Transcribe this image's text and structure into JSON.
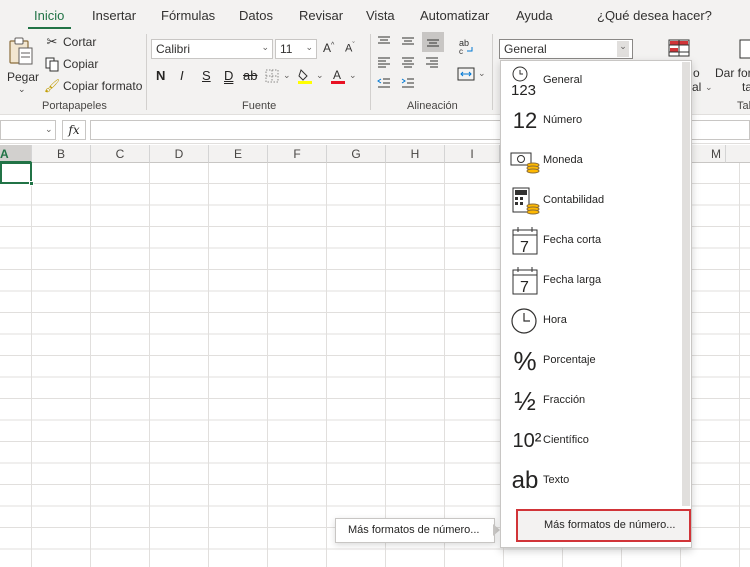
{
  "tabs": [
    {
      "label": "Inicio",
      "active": true
    },
    {
      "label": "Insertar"
    },
    {
      "label": "Fórmulas"
    },
    {
      "label": "Datos"
    },
    {
      "label": "Revisar"
    },
    {
      "label": "Vista"
    },
    {
      "label": "Automatizar"
    },
    {
      "label": "Ayuda"
    }
  ],
  "search": {
    "label": "¿Qué desea hacer?"
  },
  "clipboard": {
    "paste_label": "Pegar",
    "cut_label": "Cortar",
    "copy_label": "Copiar",
    "format_painter_label": "Copiar formato",
    "group_label": "Portapapeles"
  },
  "font": {
    "name": "Calibri",
    "size": "11",
    "group_label": "Fuente",
    "bold": "N",
    "italic": "I",
    "underline": "S",
    "double_underline": "D",
    "strikethrough": "ab"
  },
  "alignment": {
    "group_label": "Alineación"
  },
  "number": {
    "format_value": "General"
  },
  "table_styles": {
    "label_partial": "o",
    "label_partial2": "al"
  },
  "cell_styles": {
    "label_line1": "Dar for",
    "label_line2": "ta",
    "group_partial": "Tab"
  },
  "formula_bar": {
    "fx_label": "fx",
    "value": ""
  },
  "columns": [
    "A",
    "B",
    "C",
    "D",
    "E",
    "F",
    "G",
    "H",
    "I",
    "M"
  ],
  "format_menu": {
    "items": [
      {
        "label": "General",
        "icon": "general-icon",
        "glyph": "123"
      },
      {
        "label": "Número",
        "icon": "number-icon",
        "glyph": "12"
      },
      {
        "label": "Moneda",
        "icon": "currency-icon"
      },
      {
        "label": "Contabilidad",
        "icon": "accounting-icon"
      },
      {
        "label": "Fecha corta",
        "icon": "calendar-icon",
        "glyph": "7"
      },
      {
        "label": "Fecha larga",
        "icon": "calendar-icon",
        "glyph": "7"
      },
      {
        "label": "Hora",
        "icon": "clock-icon"
      },
      {
        "label": "Porcentaje",
        "icon": "percent-icon",
        "glyph": "%"
      },
      {
        "label": "Fracción",
        "icon": "fraction-icon",
        "glyph": "½"
      },
      {
        "label": "Científico",
        "icon": "scientific-icon",
        "glyph": "10²"
      },
      {
        "label": "Texto",
        "icon": "text-icon",
        "glyph": "ab"
      }
    ],
    "more_label": "Más formatos de número..."
  },
  "tooltip": {
    "label": "Más formatos de número..."
  },
  "colors": {
    "accent": "#217346",
    "highlight": "#d13438",
    "font_color": "#e81123",
    "highlight_yellow": "#ffff00"
  }
}
